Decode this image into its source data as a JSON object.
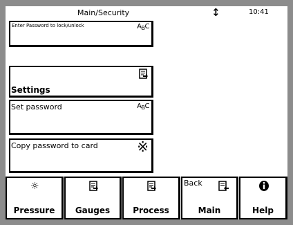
{
  "header": {
    "title": "Main/Security",
    "time": "10:41"
  },
  "rows": [
    {
      "label": "Enter Password to lock/unlock",
      "icon": "abc-keyboard-icon",
      "abc": [
        "A",
        "B",
        "C"
      ]
    },
    {
      "label": "Settings",
      "icon": "settings-page-icon"
    },
    {
      "label": "Set password",
      "icon": "abc-keyboard-icon",
      "abc": [
        "A",
        "B",
        "C"
      ]
    },
    {
      "label": "Copy password to card",
      "icon": "asterisk-icon"
    }
  ],
  "tabs": [
    {
      "label": "Pressure",
      "icon": "sun-icon"
    },
    {
      "label": "Gauges",
      "icon": "page-arrow-icon"
    },
    {
      "label": "Process",
      "icon": "page-arrow-icon"
    },
    {
      "label": "Main",
      "top_label": "Back",
      "icon": "back-page-icon"
    },
    {
      "label": "Help",
      "icon": "info-icon"
    }
  ]
}
